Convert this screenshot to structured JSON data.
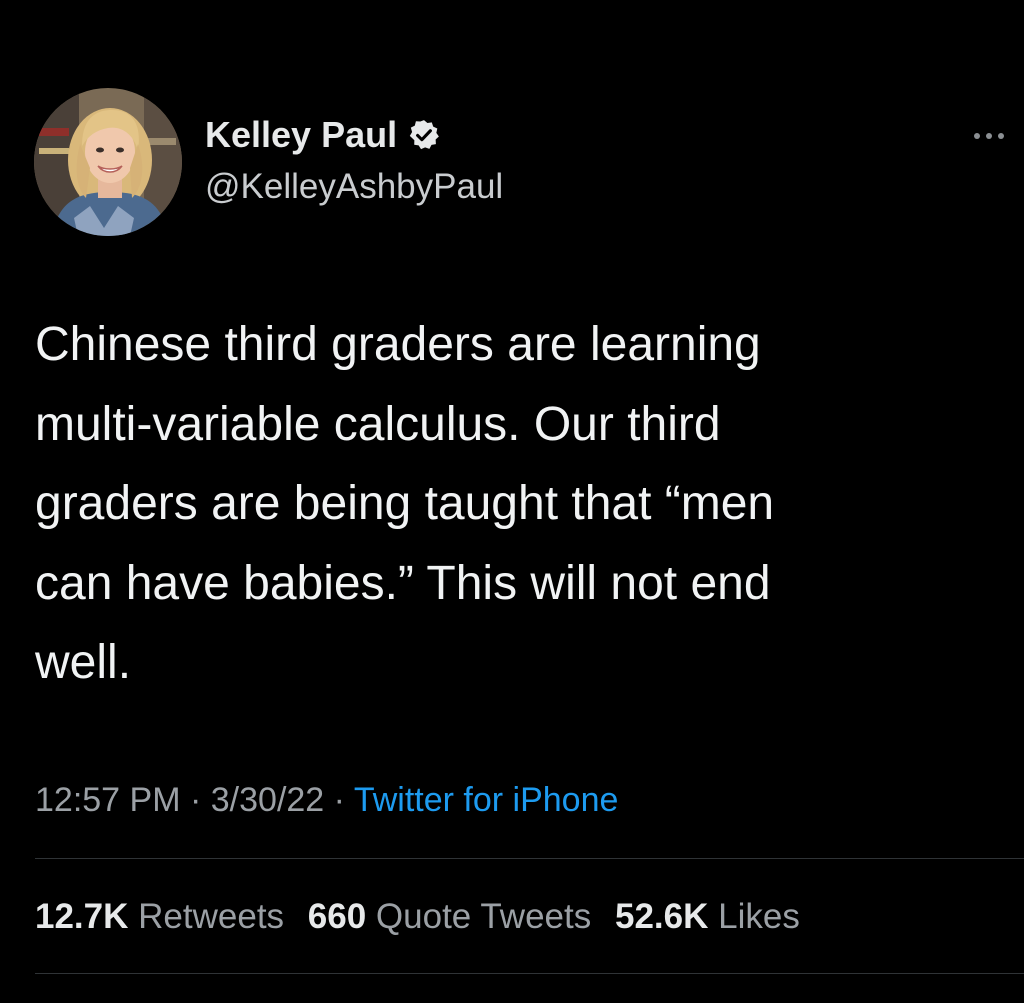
{
  "tweet": {
    "author": {
      "display_name": "Kelley Paul",
      "handle": "@KelleyAshbyPaul",
      "verified": true,
      "verified_icon": "verified-badge-icon"
    },
    "more_icon": "more-options-icon",
    "text": "Chinese third graders are learning\nmulti-variable calculus.  Our third\ngraders are being taught that “men\ncan have babies.”  This will not end\nwell.",
    "time": "12:57 PM",
    "date": "3/30/22",
    "separator": "·",
    "source": "Twitter for iPhone",
    "stats": {
      "retweets_count": "12.7K",
      "retweets_label": "Retweets",
      "quotes_count": "660",
      "quotes_label": "Quote Tweets",
      "likes_count": "52.6K",
      "likes_label": "Likes"
    }
  },
  "colors": {
    "background": "#000000",
    "text_primary": "#e7e9ea",
    "text_secondary": "#9ba0a5",
    "link": "#1d9bf0",
    "divider": "#2f3336"
  }
}
